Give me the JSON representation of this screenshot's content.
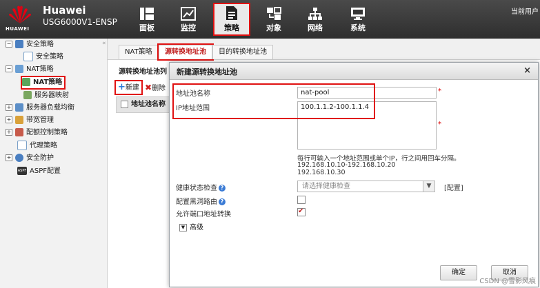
{
  "header": {
    "brand": "Huawei",
    "logo_text": "HUAWEI",
    "model": "USG6000V1-ENSP",
    "nav": [
      {
        "label": "面板",
        "icon": "dashboard-icon"
      },
      {
        "label": "监控",
        "icon": "monitor-chart-icon"
      },
      {
        "label": "策略",
        "icon": "policy-document-icon",
        "active": true
      },
      {
        "label": "对象",
        "icon": "object-icon"
      },
      {
        "label": "网络",
        "icon": "network-icon"
      },
      {
        "label": "系统",
        "icon": "system-icon"
      }
    ],
    "user": "当前用户"
  },
  "sidebar": {
    "items": [
      {
        "label": "安全策略",
        "level": 0,
        "expander": "−"
      },
      {
        "label": "安全策略",
        "level": 1
      },
      {
        "label": "NAT策略",
        "level": 0,
        "expander": "−"
      },
      {
        "label": "NAT策略",
        "level": 1,
        "selected": true
      },
      {
        "label": "服务器映射",
        "level": 1
      },
      {
        "label": "服务器负载均衡",
        "level": 0,
        "expander": "+"
      },
      {
        "label": "带宽管理",
        "level": 0,
        "expander": "+"
      },
      {
        "label": "配额控制策略",
        "level": 0,
        "expander": "+"
      },
      {
        "label": "代理策略",
        "level": 1
      },
      {
        "label": "安全防护",
        "level": 0,
        "expander": "+"
      },
      {
        "label": "ASPF配置",
        "level": 1
      }
    ]
  },
  "tabs": [
    "NAT策略",
    "源转换地址池",
    "目的转换地址池"
  ],
  "main": {
    "pool_title": "源转换地址池列",
    "add_label": "新建",
    "delete_label": "删除",
    "col_name": "地址池名称"
  },
  "dialog": {
    "title": "新建源转换地址池",
    "close": "×",
    "name_label": "地址池名称",
    "name_value": "nat-pool",
    "range_label": "IP地址范围",
    "range_value": "100.1.1.2-100.1.1.4",
    "required_mark": "*",
    "hint_line1": "每行可输入一个地址范围或单个IP，行之间用回车分隔。",
    "hint_line2": "192.168.10.10-192.168.10.20",
    "hint_line3": "192.168.10.30",
    "health_label": "健康状态检查",
    "health_placeholder": "请选择健康检查",
    "config_link": "[配置]",
    "blackhole_label": "配置黑洞路由",
    "blackhole_checked": false,
    "port_label": "允许端口地址转换",
    "port_checked": true,
    "advanced": "高级",
    "ok": "确定",
    "cancel": "取消"
  },
  "watermark": "CSDN @雪影风痕"
}
